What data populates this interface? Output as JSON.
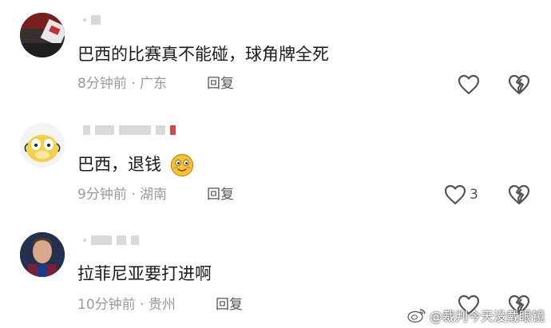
{
  "comments": [
    {
      "text": "巴西的比赛真不能碰，球角牌全死",
      "time": "8分钟前",
      "location": "广东",
      "reply_label": "回复",
      "likes": ""
    },
    {
      "text": "巴西，退钱",
      "time": "9分钟前",
      "location": "湖南",
      "reply_label": "回复",
      "likes": "3"
    },
    {
      "text": "拉菲尼亚要打进啊",
      "time": "10分钟前",
      "location": "贵州",
      "reply_label": "回复",
      "likes": ""
    }
  ],
  "meta_separator": "·",
  "watermark": "@裁判今天没戴眼镜",
  "icons": {
    "like": "heart-outline-icon",
    "dislike": "broken-heart-icon",
    "emoji": "smiling-face-emoji",
    "weibo": "weibo-logo-icon"
  },
  "colors": {
    "text": "#1a1a1a",
    "meta": "#9a9a9a",
    "icon": "#555555"
  }
}
